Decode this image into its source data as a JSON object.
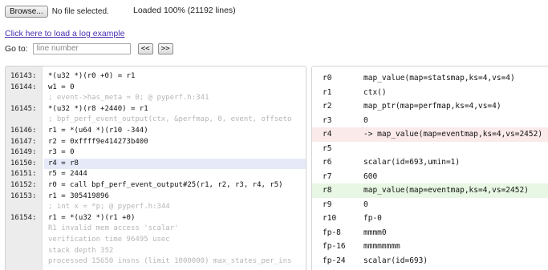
{
  "top": {
    "browse_label": "Browse...",
    "file_status": "No file selected.",
    "load_status": "Loaded 100% (21192 lines)"
  },
  "example_link": "Click here to load a log example",
  "goto": {
    "label": "Go to:",
    "placeholder": "line number",
    "prev_label": "<<",
    "next_label": ">>"
  },
  "log_lines": [
    {
      "num": "16143:",
      "text": "*(u32 *)(r0 +0) = r1",
      "kind": "code"
    },
    {
      "num": "16144:",
      "text": "w1 = 0",
      "kind": "code"
    },
    {
      "num": "",
      "text": "; event->has_meta = 0; @ pyperf.h:341",
      "kind": "comment"
    },
    {
      "num": "16145:",
      "text": "*(u32 *)(r8 +2440) = r1",
      "kind": "code"
    },
    {
      "num": "",
      "text": "; bpf_perf_event_output(ctx, &perfmap, 0, event, offseto",
      "kind": "comment"
    },
    {
      "num": "16146:",
      "text": "r1 = *(u64 *)(r10 -344)",
      "kind": "code"
    },
    {
      "num": "16147:",
      "text": "r2 = 0xffff9e414273b400",
      "kind": "code"
    },
    {
      "num": "16149:",
      "text": "r3 = 0",
      "kind": "code"
    },
    {
      "num": "16150:",
      "text": "r4 = r8",
      "kind": "selected"
    },
    {
      "num": "16151:",
      "text": "r5 = 2444",
      "kind": "code"
    },
    {
      "num": "16152:",
      "text": "r0 = call bpf_perf_event_output#25(r1, r2, r3, r4, r5)",
      "kind": "code"
    },
    {
      "num": "16153:",
      "text": "r1 = 305419896",
      "kind": "code"
    },
    {
      "num": "",
      "text": "; int x = *p; @ pyperf.h:344",
      "kind": "comment"
    },
    {
      "num": "16154:",
      "text": "r1 = *(u32 *)(r1 +0)",
      "kind": "code"
    },
    {
      "num": "",
      "text": "R1 invalid mem access 'scalar'",
      "kind": "comment"
    },
    {
      "num": "",
      "text": "verification time 96495 usec",
      "kind": "comment"
    },
    {
      "num": "",
      "text": "stack depth 352",
      "kind": "comment"
    },
    {
      "num": "",
      "text": "processed 15650 insns (limit 1000000) max_states_per_ins",
      "kind": "comment"
    }
  ],
  "registers": [
    {
      "reg": "r0",
      "value": "map_value(map=statsmap,ks=4,vs=4)",
      "state": "normal"
    },
    {
      "reg": "r1",
      "value": "ctx()",
      "state": "normal"
    },
    {
      "reg": "r2",
      "value": "map_ptr(map=perfmap,ks=4,vs=4)",
      "state": "normal"
    },
    {
      "reg": "r3",
      "value": "0",
      "state": "normal"
    },
    {
      "reg": "r4",
      "value": "-> map_value(map=eventmap,ks=4,vs=2452)",
      "state": "changed"
    },
    {
      "reg": "r5",
      "value": "",
      "state": "normal"
    },
    {
      "reg": "r6",
      "value": "scalar(id=693,umin=1)",
      "state": "normal"
    },
    {
      "reg": "r7",
      "value": "600",
      "state": "normal"
    },
    {
      "reg": "r8",
      "value": "map_value(map=eventmap,ks=4,vs=2452)",
      "state": "used"
    },
    {
      "reg": "r9",
      "value": "0",
      "state": "normal"
    },
    {
      "reg": "r10",
      "value": "fp-0",
      "state": "normal"
    },
    {
      "reg": "fp-8",
      "value": "mmmm0",
      "state": "normal"
    },
    {
      "reg": "fp-16",
      "value": "mmmmmmmm",
      "state": "normal"
    },
    {
      "reg": "fp-24",
      "value": "scalar(id=693)",
      "state": "normal"
    }
  ],
  "colors": {
    "selected_line": "#e6eaf8",
    "changed_register": "#fbeaea",
    "used_register": "#e7f7e3",
    "link": "#4a2fb0",
    "comment_text": "#b6b6b6"
  }
}
